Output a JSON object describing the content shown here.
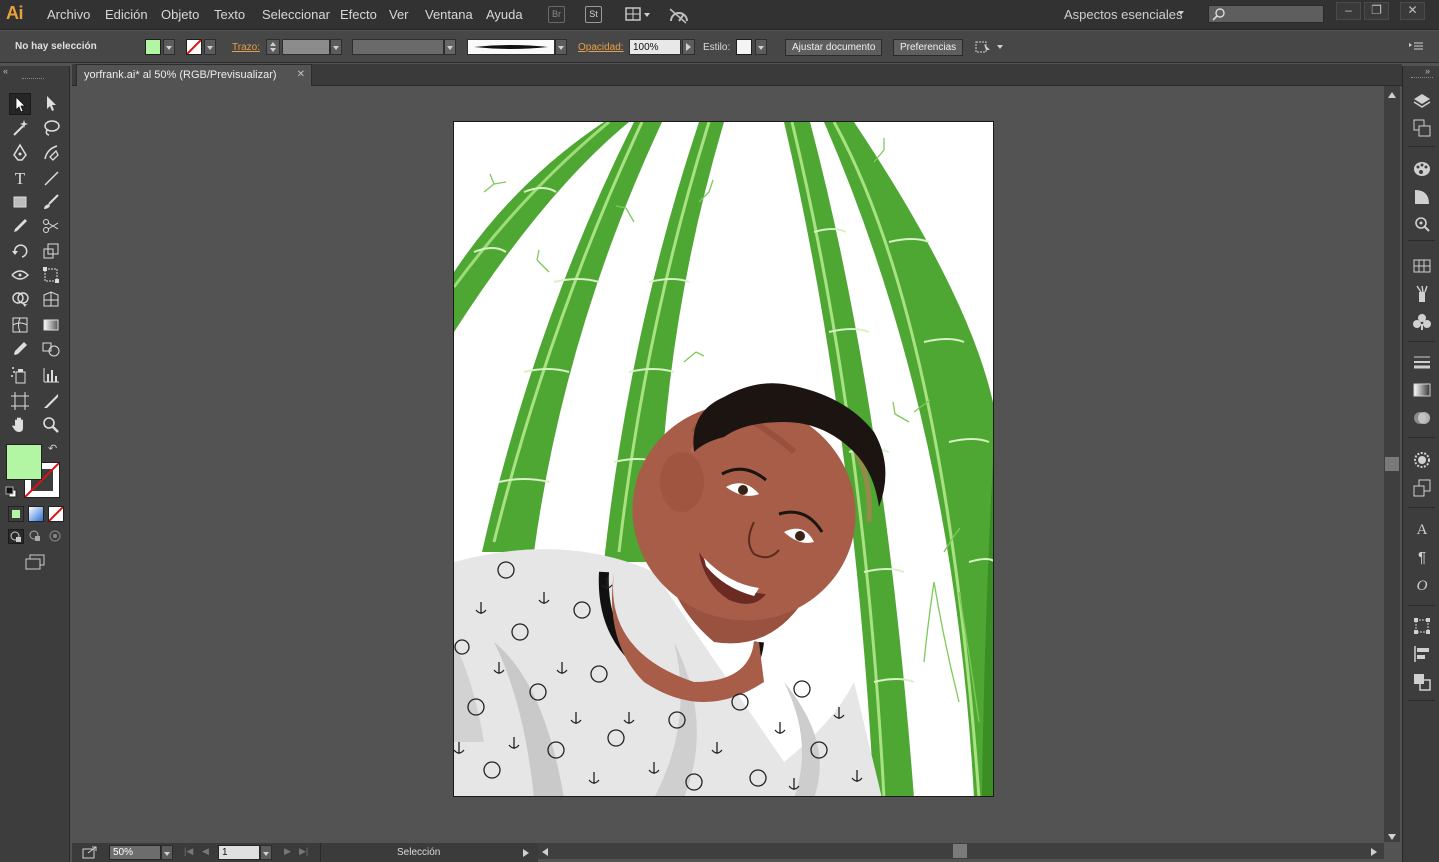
{
  "app": {
    "logo": "Ai"
  },
  "menu": [
    "Archivo",
    "Edición",
    "Objeto",
    "Texto",
    "Seleccionar",
    "Efecto",
    "Ver",
    "Ventana",
    "Ayuda"
  ],
  "menubar_icons": {
    "bridge": "Br",
    "stock": "St"
  },
  "workspace": {
    "label": "Aspectos esenciales"
  },
  "control": {
    "selection_status": "No hay selección",
    "stroke_label": "Trazo:",
    "opacity_label": "Opacidad:",
    "opacity_value": "100%",
    "style_label": "Estilo:",
    "fit_document_button": "Ajustar documento",
    "preferences_button": "Preferencias"
  },
  "document": {
    "tab_title": "yorfrank.ai* al 50% (RGB/Previsualizar)"
  },
  "status": {
    "zoom": "50%",
    "page": "1",
    "current_tool": "Selección"
  },
  "colors": {
    "fill": "#b2f5a3",
    "bamboo_green": "#4ea733",
    "skin": "#a85d48",
    "hair": "#1c1410"
  }
}
